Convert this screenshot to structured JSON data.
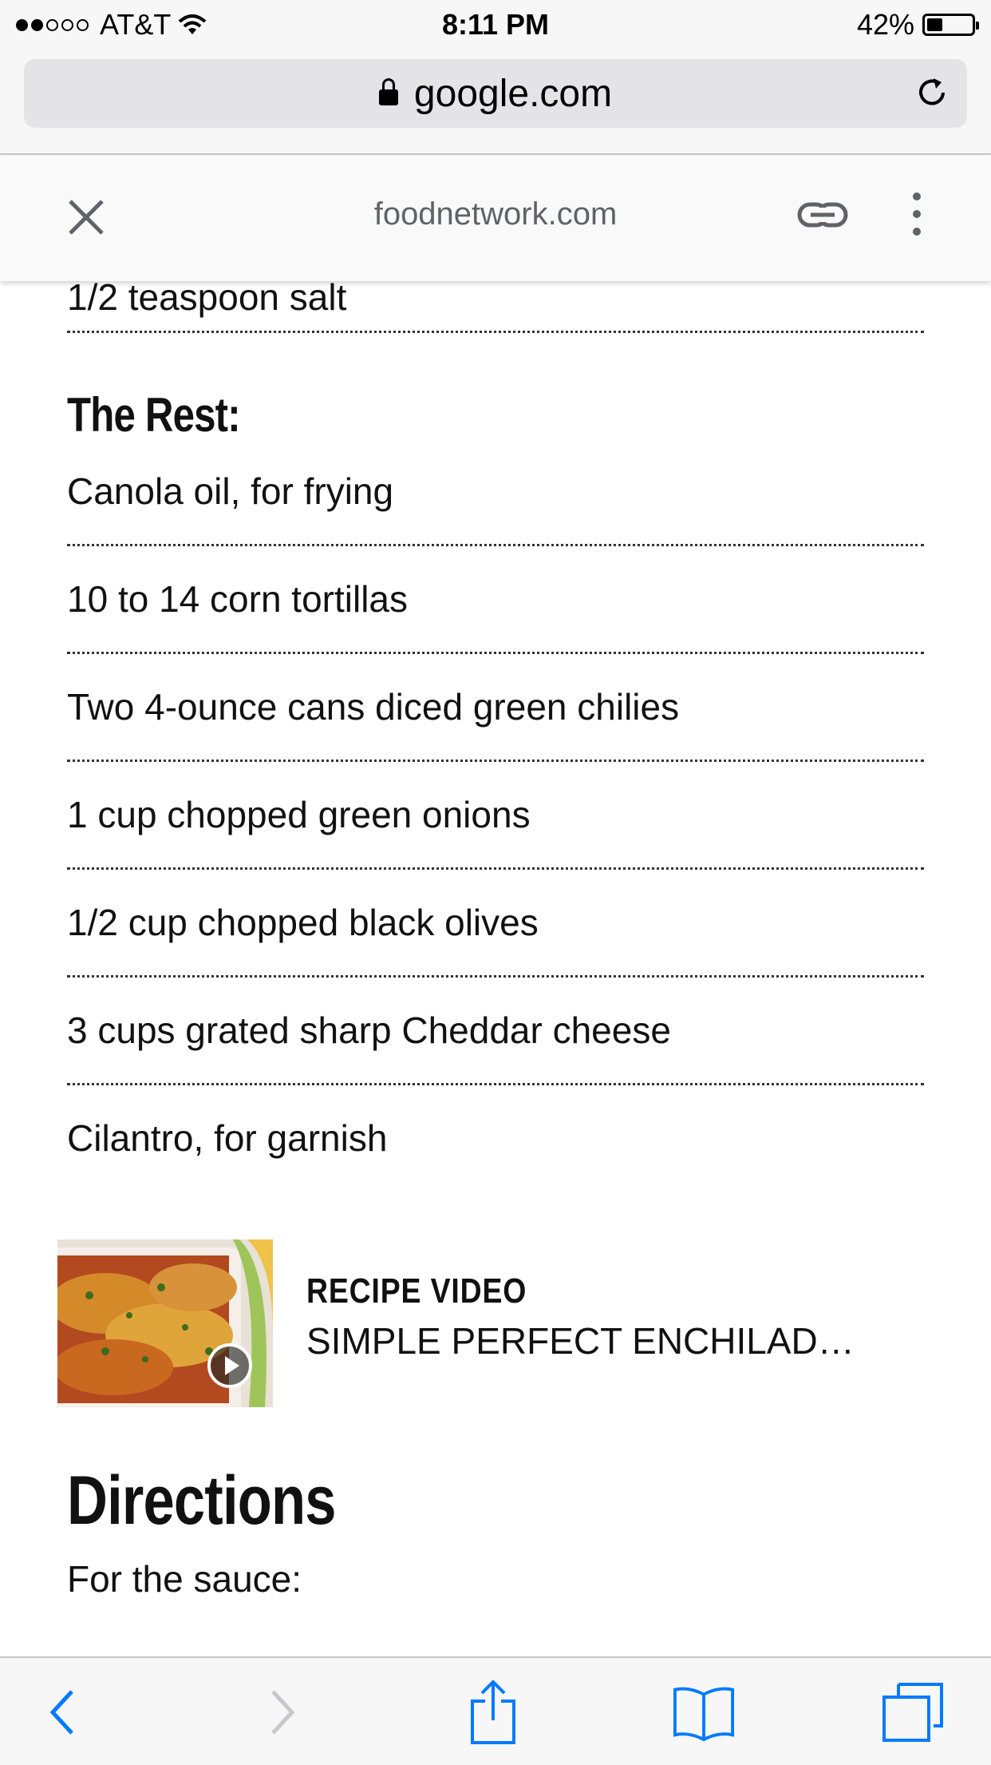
{
  "status_bar": {
    "carrier": "AT&T",
    "time": "8:11 PM",
    "battery": "42%",
    "battery_level": 0.42,
    "signal_bars_filled": 2,
    "signal_bars_total": 5
  },
  "browser": {
    "url": "google.com",
    "icons": [
      "lock-icon",
      "reload-icon"
    ]
  },
  "amp_header": {
    "domain": "foodnetwork.com",
    "icons": [
      "close-icon",
      "link-icon",
      "more-icon"
    ]
  },
  "content": {
    "previous_item": "1/2 teaspoon salt",
    "section_title": "The Rest:",
    "ingredients": [
      "Canola oil, for frying",
      "10 to 14 corn tortillas",
      "Two 4-ounce cans diced green chilies",
      "1 cup chopped green onions",
      "1/2 cup chopped black olives",
      "3 cups grated sharp Cheddar cheese",
      "Cilantro, for garnish"
    ],
    "video": {
      "kicker": "RECIPE VIDEO",
      "title": "SIMPLE PERFECT ENCHILAD…"
    },
    "directions_title": "Directions",
    "directions_subtitle": "For the sauce:"
  },
  "toolbar": {
    "icons": [
      "back-icon",
      "forward-icon",
      "share-icon",
      "bookmarks-icon",
      "tabs-icon"
    ],
    "accent": "#007aff",
    "disabled": "#c7c7cc"
  }
}
